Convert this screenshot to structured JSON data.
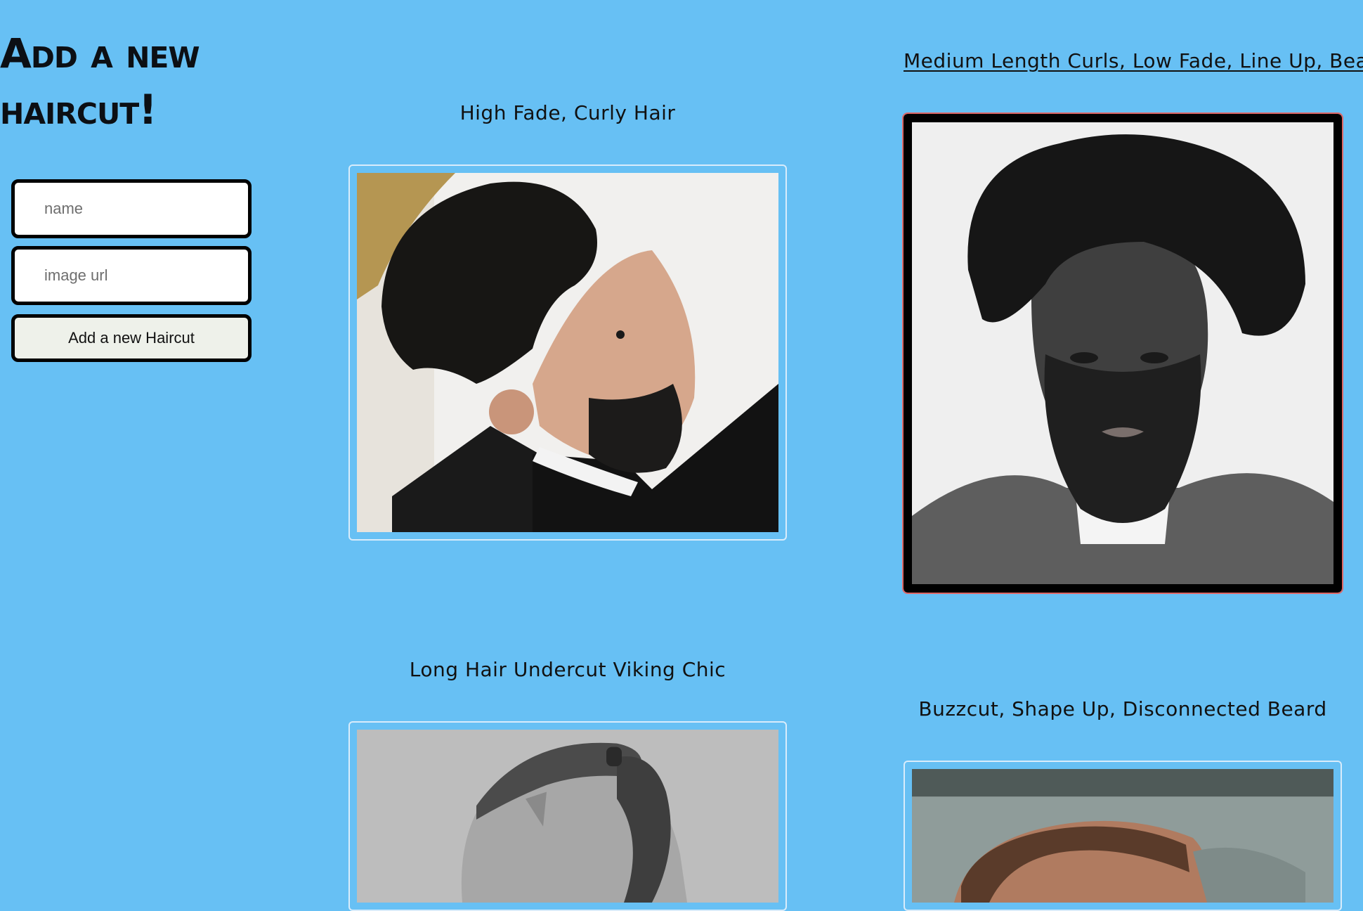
{
  "sidebar": {
    "title": "Add a new haircut!",
    "name_placeholder": "name",
    "url_placeholder": "image url",
    "add_button_label": "Add a new Haircut"
  },
  "haircuts": [
    {
      "name": "High Fade, Curly Hair",
      "photo_icon": "curly-high-fade-photo"
    },
    {
      "name": "Medium Length Curls, Low Fade, Line Up, Beard",
      "photo_icon": "medium-curls-photo",
      "selected": true
    },
    {
      "name": "Long Hair Undercut Viking Chic",
      "photo_icon": "viking-undercut-photo"
    },
    {
      "name": "Buzzcut, Shape Up, Disconnected Beard",
      "photo_icon": "buzzcut-photo"
    }
  ],
  "colors": {
    "background": "#67c0f4",
    "frame_border": "#d8ecfb",
    "selected_border": "#000000"
  }
}
